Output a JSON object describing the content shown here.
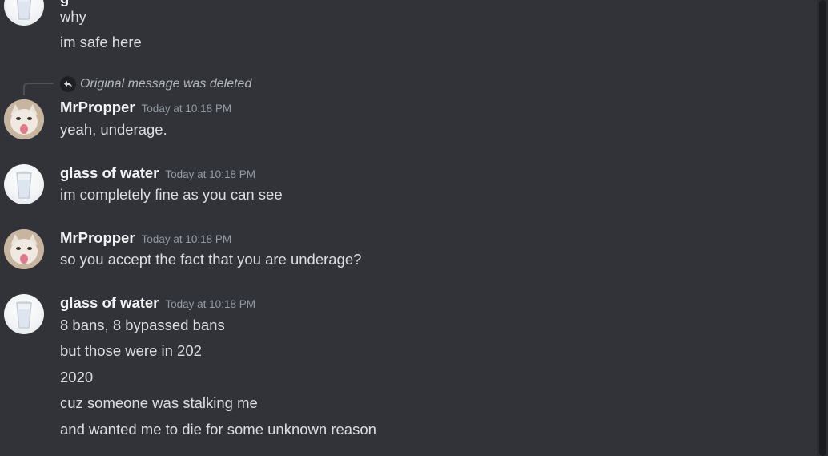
{
  "messages": {
    "top": {
      "lines": [
        "why",
        "im safe here"
      ]
    },
    "reply": {
      "text": "Original message was deleted"
    },
    "m1": {
      "username": "MrPropper",
      "timestamp": "Today at 10:18 PM",
      "lines": [
        "yeah, underage."
      ]
    },
    "m2": {
      "username": "glass of water",
      "timestamp": "Today at 10:18 PM",
      "lines": [
        "im completely fine as you can see"
      ]
    },
    "m3": {
      "username": "MrPropper",
      "timestamp": "Today at 10:18 PM",
      "lines": [
        "so you accept the fact that you are underage?"
      ]
    },
    "m4": {
      "username": "glass of water",
      "timestamp": "Today at 10:18 PM",
      "lines": [
        "8 bans, 8 bypassed bans",
        "but those were in 202",
        "2020",
        "cuz someone was stalking me",
        "and wanted me to die for some unknown reason"
      ]
    }
  },
  "colors": {
    "background": "#313338",
    "username": "#f2f3f5",
    "timestamp": "#949ba4",
    "text": "#dbdee1"
  }
}
